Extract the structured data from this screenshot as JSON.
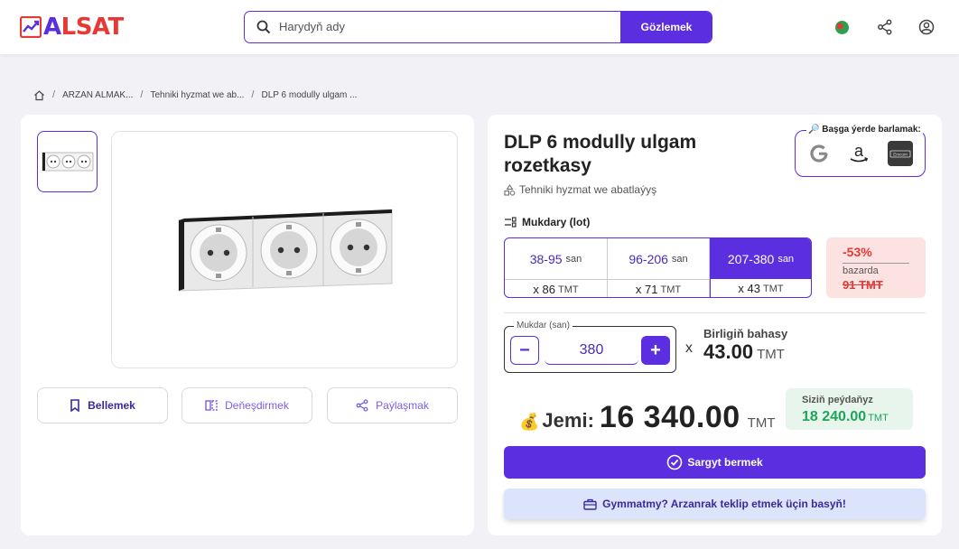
{
  "header": {
    "logo_text": "ALSAT",
    "search": {
      "placeholder": "Harydyň ady",
      "button_label": "Gözlemek"
    },
    "icons": [
      "language-globe-icon",
      "share-icon",
      "user-account-icon"
    ]
  },
  "breadcrumb": {
    "items": [
      "ARZAN ALMAK...",
      "Tehniki hyzmat we ab...",
      "DLP 6 modully ulgam ..."
    ]
  },
  "gallery": {
    "actions": [
      {
        "label": "Bellemek",
        "icon": "bookmark-icon"
      },
      {
        "label": "Deňeşdirmek",
        "icon": "compare-icon"
      },
      {
        "label": "Paýlaşmak",
        "icon": "share-icon"
      }
    ]
  },
  "product": {
    "title": "DLP 6 modully ulgam rozetkasy",
    "category": "Tehniki hyzmat we abatlaýyş"
  },
  "search_elsewhere": {
    "label": "🔎 Başga ýerde barlamak:",
    "sources": [
      {
        "name": "Google",
        "icon": "google-icon"
      },
      {
        "name": "Amazon",
        "icon": "amazon-icon"
      },
      {
        "name": "Emcom",
        "icon": "emcom-icon"
      }
    ]
  },
  "quantity": {
    "label": "Mukdary (lot)",
    "unit": "san",
    "currency": "TMT",
    "tiers": [
      {
        "range": "38-95",
        "price_prefix": "x",
        "price": "86",
        "selected": false
      },
      {
        "range": "96-206",
        "price_prefix": "x",
        "price": "71",
        "selected": false
      },
      {
        "range": "207-380",
        "price_prefix": "x",
        "price": "43",
        "selected": true
      }
    ]
  },
  "discount": {
    "percent": "-53%",
    "label": "bazarda",
    "old_price": "91 TMT"
  },
  "stepper": {
    "label": "Mukdar (san)",
    "value": "380",
    "minus": "−",
    "plus": "+"
  },
  "unit_price": {
    "times": "x",
    "label": "Birligiň bahasy",
    "value": "43.00",
    "currency": "TMT"
  },
  "total": {
    "label": "Jemi:",
    "value": "16 340.00",
    "currency": "TMT"
  },
  "profit": {
    "label": "Siziň peýdaňyz",
    "value": "18 240.00",
    "currency": "TMT"
  },
  "buttons": {
    "order": "Sargyt bermek",
    "offer": "Gymmatmy? Arzanrak teklip etmek üçin basyň!"
  },
  "colors": {
    "accent": "#5b2ee0",
    "brand_red": "#e53935",
    "profit_green": "#1fa55a"
  }
}
